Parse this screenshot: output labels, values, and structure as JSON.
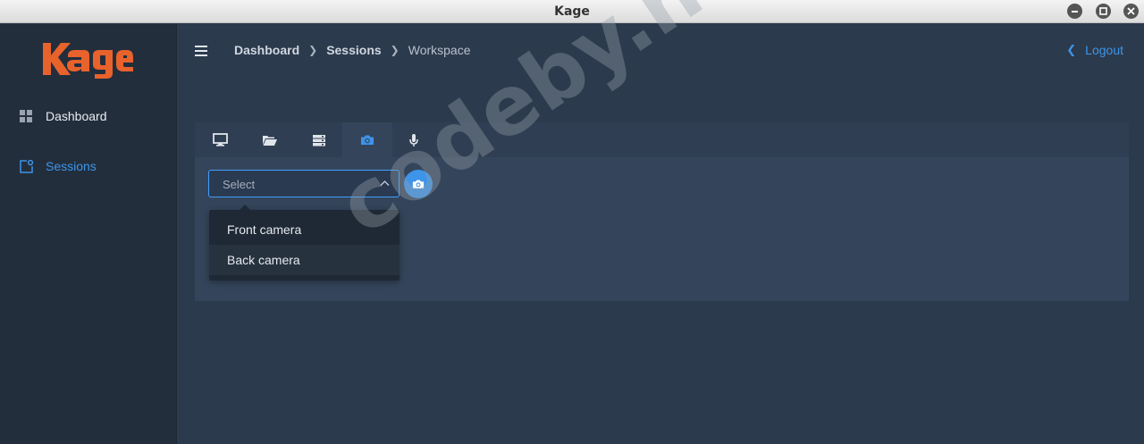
{
  "window": {
    "title": "Kage"
  },
  "brand": {
    "logo_text": "Kage",
    "color": "#e8622c"
  },
  "sidebar": {
    "items": [
      {
        "label": "Dashboard",
        "icon": "grid-icon",
        "active": false
      },
      {
        "label": "Sessions",
        "icon": "sessions-icon",
        "active": true
      }
    ]
  },
  "header": {
    "breadcrumbs": [
      "Dashboard",
      "Sessions",
      "Workspace"
    ],
    "logout_label": "Logout"
  },
  "tabs": [
    {
      "icon": "monitor-icon",
      "active": false
    },
    {
      "icon": "folder-open-icon",
      "active": false
    },
    {
      "icon": "server-icon",
      "active": false
    },
    {
      "icon": "camera-icon",
      "active": true
    },
    {
      "icon": "microphone-icon",
      "active": false
    }
  ],
  "camera": {
    "select_placeholder": "Select",
    "options": [
      "Front camera",
      "Back camera"
    ],
    "highlighted_option": "Back camera"
  },
  "watermark": "codeby.net",
  "colors": {
    "accent": "#3d94e8",
    "sidebar_bg": "#232e3c",
    "main_bg": "#2c3a4d"
  }
}
